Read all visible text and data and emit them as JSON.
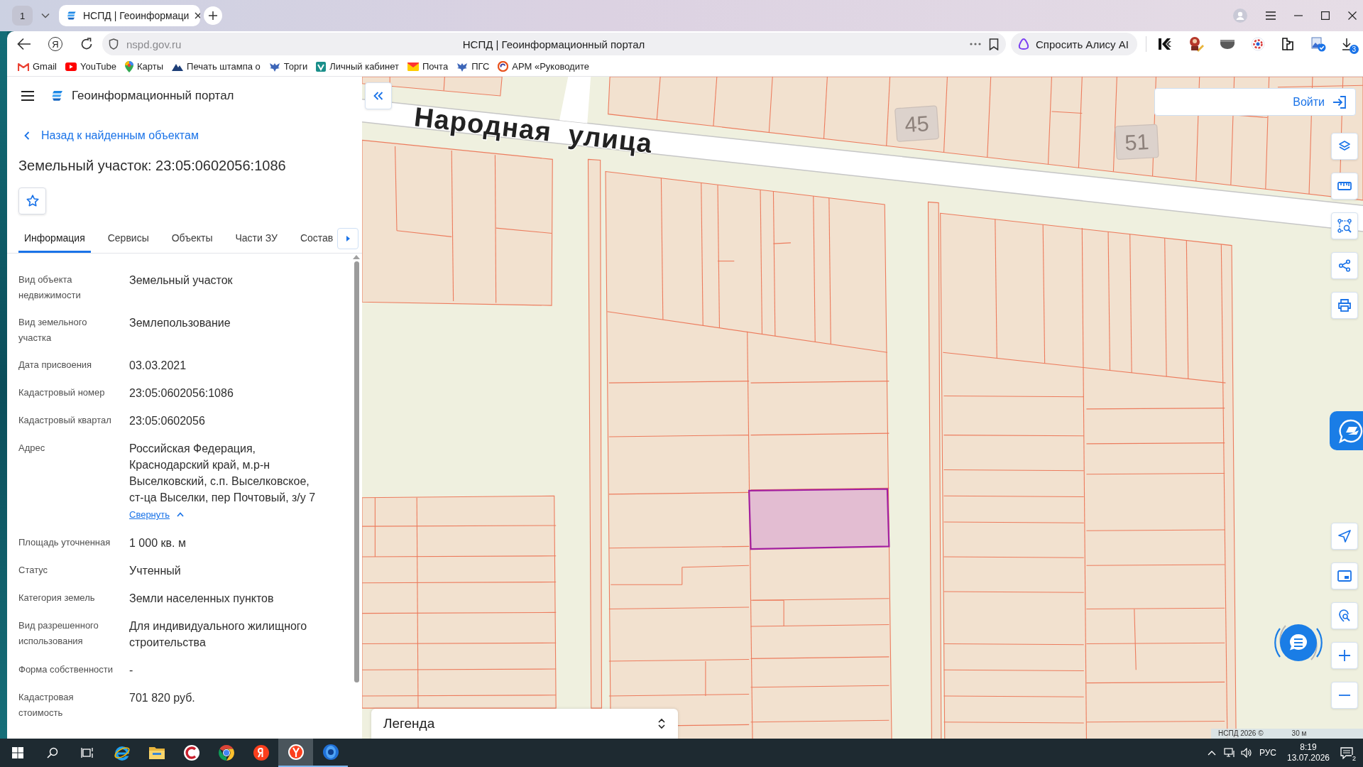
{
  "browser": {
    "tab_count": "1",
    "tabs": [
      {
        "title": "НСПД | Геоинформаци",
        "selected": true
      }
    ],
    "home_button": "Я",
    "address": {
      "url": "nspd.gov.ru",
      "page_title": "НСПД | Геоинформационный портал"
    },
    "alice_button": "Спросить Алису AI",
    "downloads_badge": "3"
  },
  "bookmarks": [
    {
      "label": "Gmail",
      "kind": "m_logo"
    },
    {
      "label": "YouTube",
      "kind": "play"
    },
    {
      "label": "Карты",
      "kind": "pin"
    },
    {
      "label": "Печать штампа о",
      "kind": "mountain"
    },
    {
      "label": "Торги",
      "kind": "emblem"
    },
    {
      "label": "Личный кабинет",
      "kind": "square_logo"
    },
    {
      "label": "Почта",
      "kind": "envelope"
    },
    {
      "label": "ПГС",
      "kind": "emblem"
    },
    {
      "label": "АРМ «Руководите",
      "kind": "swirl"
    }
  ],
  "portal": {
    "title": "Геоинформационный портал"
  },
  "panel": {
    "back_link": "Назад к найденным объектам",
    "heading": "Земельный участок: 23:05:0602056:1086",
    "starred": false,
    "tabs": [
      {
        "label": "Информация",
        "selected": true
      },
      {
        "label": "Сервисы",
        "selected": false
      },
      {
        "label": "Объекты",
        "selected": false
      },
      {
        "label": "Части ЗУ",
        "selected": false
      },
      {
        "label": "Состав",
        "selected": false
      }
    ],
    "properties": [
      {
        "label": "Вид объекта недвижимости",
        "value": "Земельный участок"
      },
      {
        "label": "Вид земельного участка",
        "value": "Землепользование"
      },
      {
        "label": "Дата присвоения",
        "value": "03.03.2021"
      },
      {
        "label": "Кадастровый номер",
        "value": "23:05:0602056:1086"
      },
      {
        "label": "Кадастровый квартал",
        "value": "23:05:0602056"
      },
      {
        "label": "Адрес",
        "value": "Российская Федерация, Краснодарский край, м.р-н Выселковский, с.п. Выселковское, ст-ца Выселки, пер Почтовый, з/у 7",
        "toggle": {
          "label": "Свернуть",
          "expanded": true
        }
      },
      {
        "label": "Площадь уточненная",
        "value": "1 000 кв. м"
      },
      {
        "label": "Статус",
        "value": "Учтенный"
      },
      {
        "label": "Категория земель",
        "value": "Земли населенных пунктов"
      },
      {
        "label": "Вид разрешенного использования",
        "value": "Для индивидуального жилищного строительства"
      },
      {
        "label": "Форма собственности",
        "value": "-"
      },
      {
        "label": "Кадастровая стоимость",
        "value": "701 820 руб."
      }
    ]
  },
  "map": {
    "street_label": "Народная улица",
    "house_numbers": [
      "45",
      "51"
    ],
    "login_button": "Войти",
    "legend": "Легенда",
    "attribution": "НСПД 2026 ©",
    "scale": "30 м"
  },
  "taskbar": {
    "apps": [
      {
        "kind": "e_logo",
        "active": false,
        "running": false
      },
      {
        "kind": "folder",
        "active": false,
        "running": false
      },
      {
        "kind": "c_logo",
        "active": false,
        "running": false
      },
      {
        "kind": "segmented_circle",
        "active": false,
        "running": false
      },
      {
        "kind": "circle_logo",
        "active": false,
        "running": false
      },
      {
        "kind": "round_logo",
        "active": true,
        "running": true
      },
      {
        "kind": "sphere",
        "active": false,
        "running": true
      }
    ],
    "language": "РУС",
    "time": "8:19",
    "date": "13.07.2026",
    "notifications": "2"
  }
}
